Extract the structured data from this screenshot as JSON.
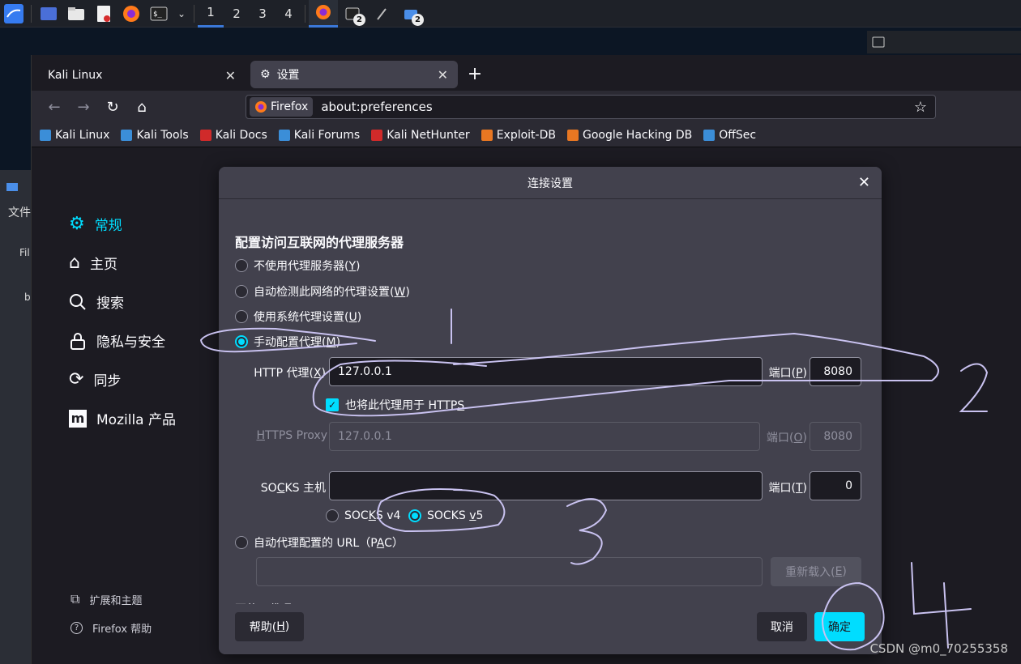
{
  "panel": {
    "workspaces": [
      "1",
      "2",
      "3",
      "4"
    ],
    "active_workspace": "1",
    "terminal_badge": "2",
    "folder_badge": "2"
  },
  "browser": {
    "tabs": [
      {
        "label": "Kali Linux"
      },
      {
        "label": "设置"
      }
    ],
    "identity_label": "Firefox",
    "url": "about:preferences",
    "bookmarks": [
      {
        "label": "Kali Linux",
        "color": "#3b8ed8"
      },
      {
        "label": "Kali Tools",
        "color": "#3b8ed8"
      },
      {
        "label": "Kali Docs",
        "color": "#d02a2a"
      },
      {
        "label": "Kali Forums",
        "color": "#3b8ed8"
      },
      {
        "label": "Kali NetHunter",
        "color": "#d02a2a"
      },
      {
        "label": "Exploit-DB",
        "color": "#e87722"
      },
      {
        "label": "Google Hacking DB",
        "color": "#e87722"
      },
      {
        "label": "OffSec",
        "color": "#3b8ed8"
      }
    ]
  },
  "bgwin_left": {
    "label": "文件",
    "line1": "Fil",
    "line2": "b"
  },
  "sidebar": {
    "items": [
      {
        "label": "常规"
      },
      {
        "label": "主页"
      },
      {
        "label": "搜索"
      },
      {
        "label": "隐私与安全"
      },
      {
        "label": "同步"
      },
      {
        "label": "Mozilla 产品"
      }
    ],
    "footer": [
      {
        "label": "扩展和主题"
      },
      {
        "label": "Firefox 帮助"
      }
    ]
  },
  "dialog": {
    "title": "连接设置",
    "heading": "配置访问互联网的代理服务器",
    "options": {
      "no_proxy": {
        "label": "不使用代理服务器(",
        "key": "Y",
        "tail": ")"
      },
      "auto_detect": {
        "label": "自动检测此网络的代理设置(",
        "key": "W",
        "tail": ")"
      },
      "system": {
        "label": "使用系统代理设置(",
        "key": "U",
        "tail": ")"
      },
      "manual": {
        "label": "手动配置代理(",
        "key": "M",
        "tail": ")"
      },
      "pac": {
        "label": "自动代理配置的 URL（P",
        "key": "A",
        "tail": "C）"
      }
    },
    "http": {
      "label_prefix": "HTTP 代理(",
      "key": "X",
      "label_suffix": ")",
      "value": "127.0.0.1",
      "port_label_prefix": "端口(",
      "port_key": "P",
      "port_label_suffix": ")",
      "port": "8080"
    },
    "also_https": {
      "label_prefix": "也将此代理用于 HTTP",
      "key": "S",
      "checked": true
    },
    "https": {
      "key": "H",
      "label_rest": "TTPS Proxy",
      "value": "127.0.0.1",
      "port_label_prefix": "端口(",
      "port_key": "O",
      "port_label_suffix": ")",
      "port": "8080"
    },
    "socks": {
      "label_prefix": "SO",
      "key": "C",
      "label_suffix": "KS 主机",
      "value": "",
      "port_label_prefix": "端口(",
      "port_key": "T",
      "port_label_suffix": ")",
      "port": "0"
    },
    "socks_v4": {
      "prefix": "SOC",
      "key": "K",
      "suffix": "S v4"
    },
    "socks_v5": {
      "prefix": "SOCKS ",
      "key": "v",
      "suffix": "5"
    },
    "pac_url": "",
    "reload_label": "重新载入(",
    "reload_key": "E",
    "reload_tail": ")",
    "cut_text": "不使用代理(N)",
    "help": {
      "label": "帮助(",
      "key": "H",
      "tail": ")"
    },
    "cancel": "取消",
    "ok": "确定"
  },
  "annotations": {
    "mark2": "2",
    "mark3": "3",
    "mark4": "4"
  },
  "watermark": "CSDN @m0_70255358",
  "colors": {
    "accent": "#00ddff",
    "dialog_bg": "#42414d",
    "page_bg": "#1c1b22",
    "annotation": "#c9c2f0"
  }
}
